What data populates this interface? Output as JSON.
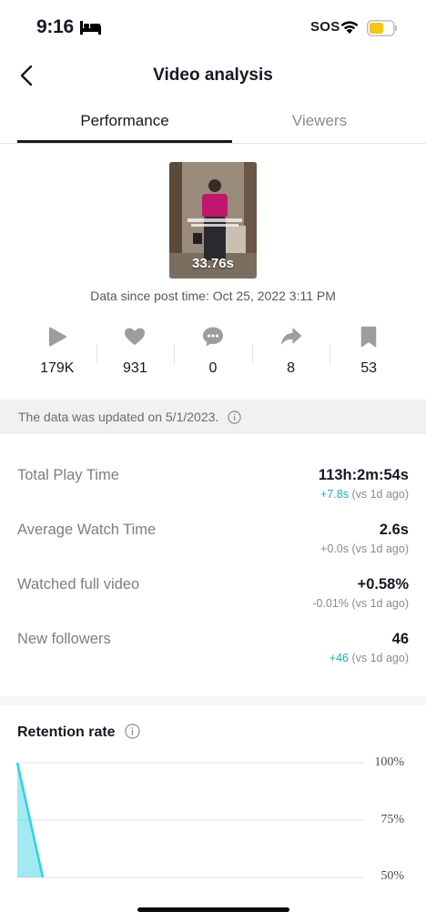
{
  "status_bar": {
    "time": "9:16",
    "sos": "SOS",
    "battery_color": "#f5c518"
  },
  "nav": {
    "title": "Video analysis"
  },
  "tabs": [
    {
      "label": "Performance",
      "active": true
    },
    {
      "label": "Viewers",
      "active": false
    }
  ],
  "video": {
    "duration": "33.76s"
  },
  "post_time": "Data since post time: Oct 25, 2022 3:11 PM",
  "stats": [
    {
      "icon": "play-icon",
      "value": "179K"
    },
    {
      "icon": "heart-icon",
      "value": "931"
    },
    {
      "icon": "comment-icon",
      "value": "0"
    },
    {
      "icon": "share-icon",
      "value": "8"
    },
    {
      "icon": "bookmark-icon",
      "value": "53"
    }
  ],
  "update_banner": "The data was updated on 5/1/2023.",
  "metrics": [
    {
      "label": "Total Play Time",
      "value": "113h:2m:54s",
      "delta": "+7.8s",
      "delta_suffix": " (vs 1d ago)",
      "delta_highlight": true
    },
    {
      "label": "Average Watch Time",
      "value": "2.6s",
      "delta": "+0.0s",
      "delta_suffix": " (vs 1d ago)",
      "delta_highlight": false
    },
    {
      "label": "Watched full video",
      "value": "+0.58%",
      "delta": "-0.01%",
      "delta_suffix": " (vs 1d ago)",
      "delta_highlight": false
    },
    {
      "label": "New followers",
      "value": "46",
      "delta": "+46",
      "delta_suffix": " (vs 1d ago)",
      "delta_highlight": true
    }
  ],
  "retention": {
    "title": "Retention rate"
  },
  "chart_data": {
    "type": "area",
    "title": "Retention rate",
    "y_ticks": [
      "100%",
      "75%",
      "50%"
    ],
    "ylim": [
      50,
      100
    ],
    "series": [
      {
        "values": [
          100,
          50
        ]
      }
    ],
    "grid": true,
    "color": "#2fd0e3"
  },
  "colors": {
    "accent": "#20a9c4",
    "text_primary": "#161823",
    "text_secondary": "#7d7e84"
  }
}
